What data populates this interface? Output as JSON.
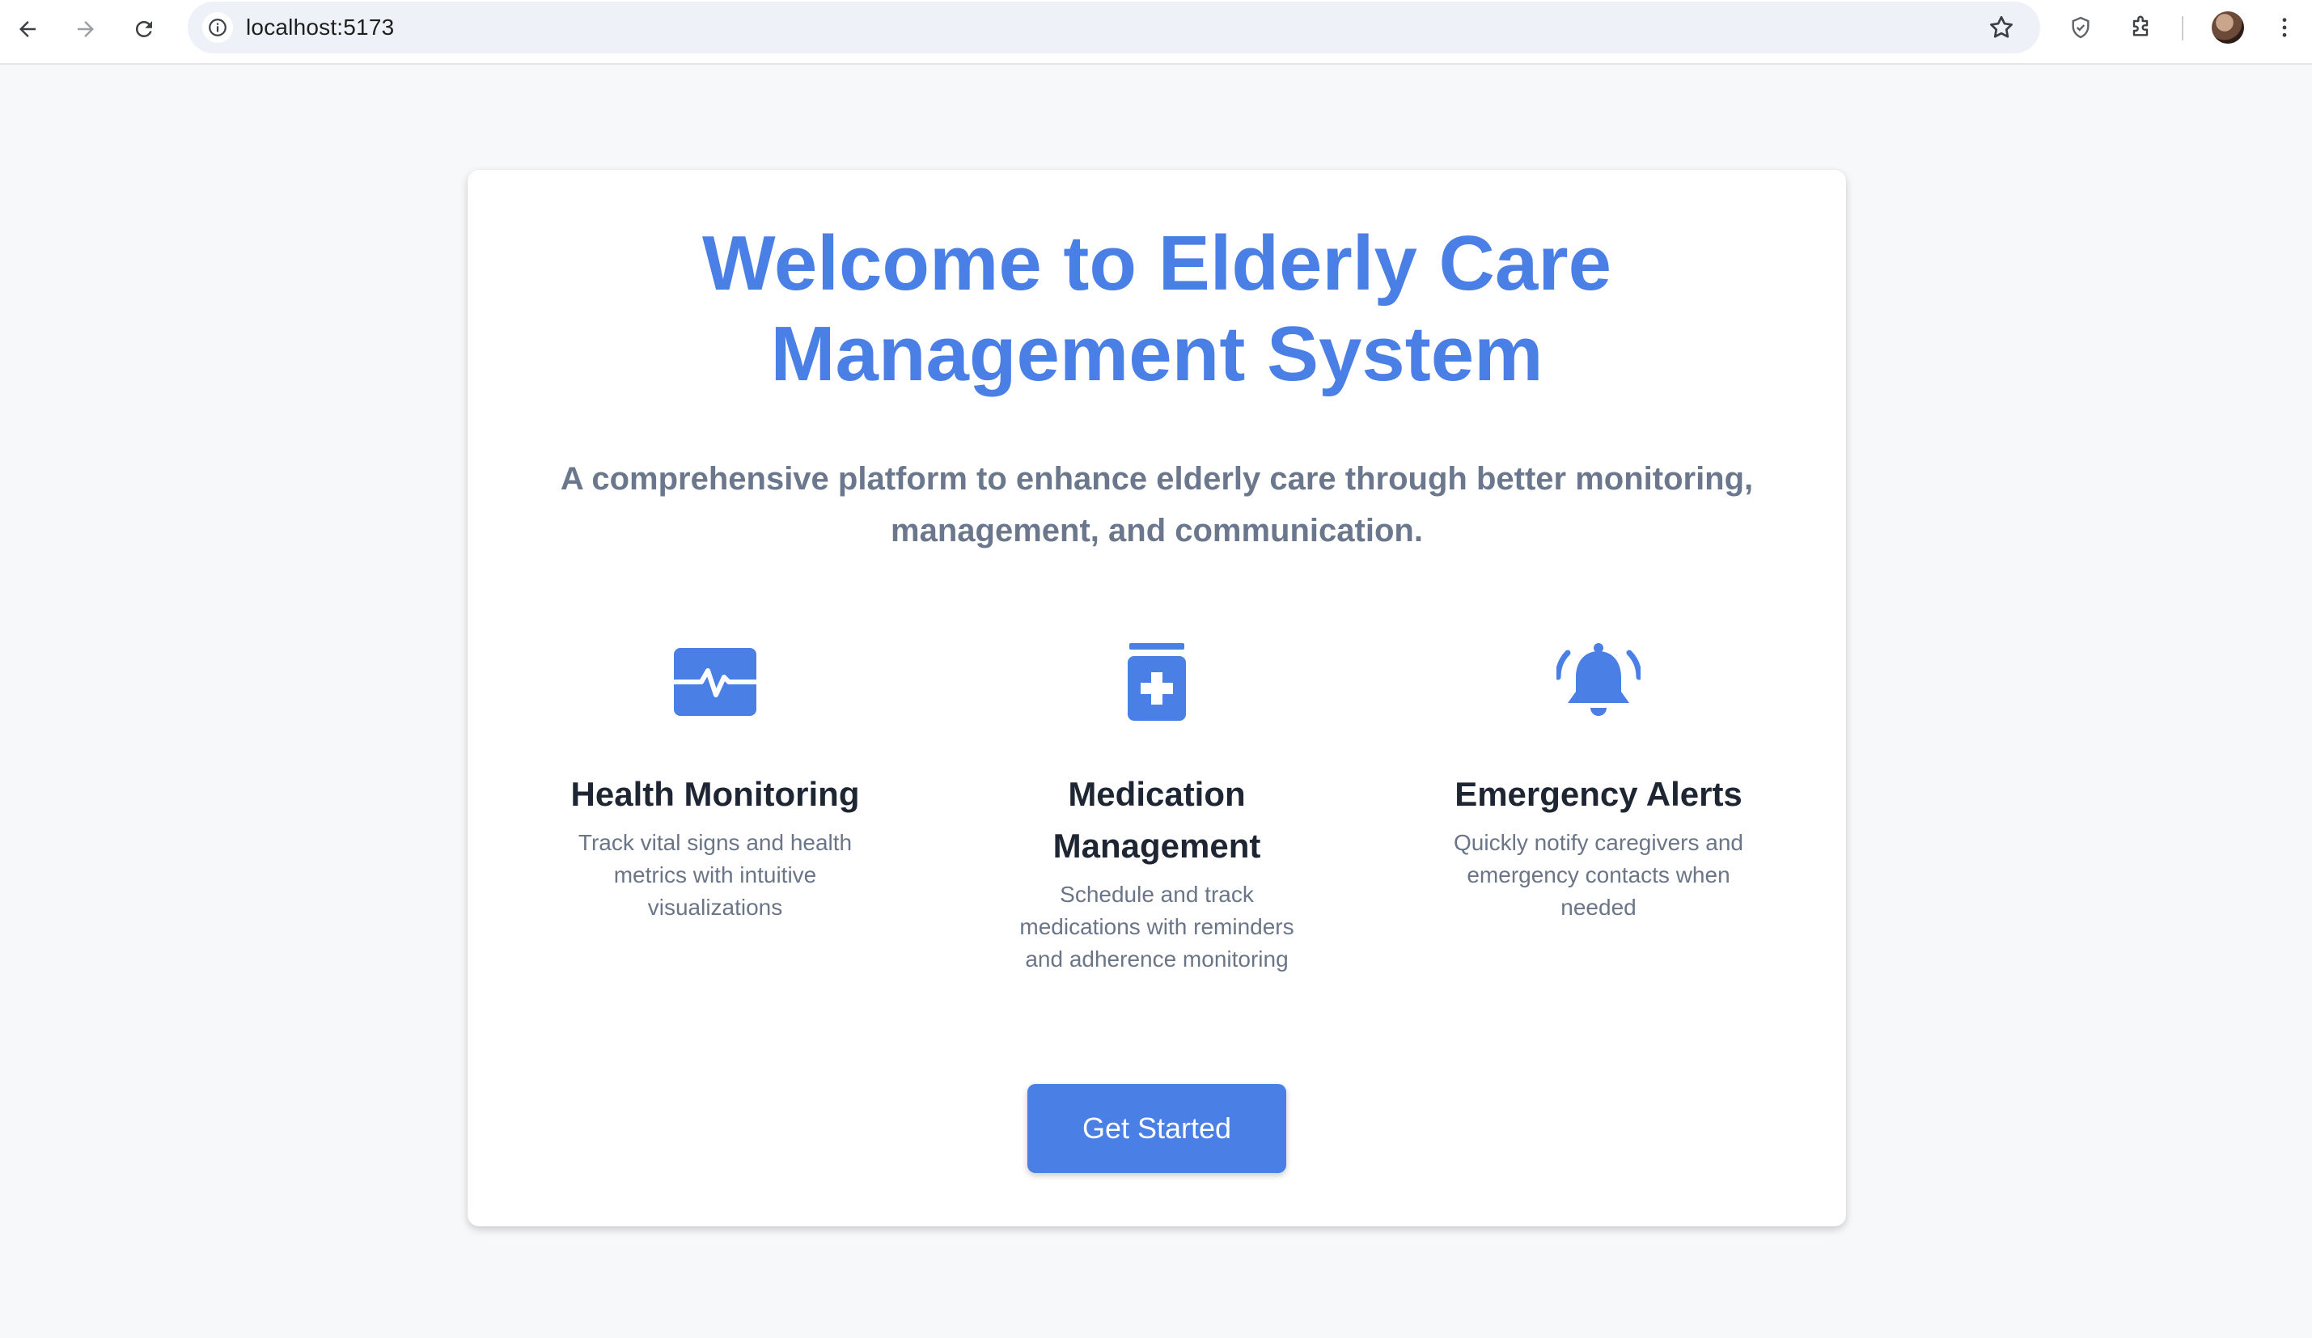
{
  "browser": {
    "url": "localhost:5173"
  },
  "hero": {
    "title_line1": "Welcome to Elderly Care",
    "title_line2": "Management System",
    "subtitle_line1": "A comprehensive platform to enhance elderly care through better monitoring,",
    "subtitle_line2": "management, and communication."
  },
  "features": [
    {
      "icon": "heartbeat-icon",
      "title_line1": "Health Monitoring",
      "title_line2": "",
      "desc_line1": "Track vital signs and health",
      "desc_line2": "metrics with intuitive",
      "desc_line3": "visualizations"
    },
    {
      "icon": "medication-bottle-icon",
      "title_line1": "Medication",
      "title_line2": "Management",
      "desc_line1": "Schedule and track",
      "desc_line2": "medications with reminders",
      "desc_line3": "and adherence monitoring"
    },
    {
      "icon": "alarm-bell-icon",
      "title_line1": "Emergency Alerts",
      "title_line2": "",
      "desc_line1": "Quickly notify caregivers and",
      "desc_line2": "emergency contacts when",
      "desc_line3": "needed"
    }
  ],
  "cta": {
    "label": "Get Started"
  },
  "colors": {
    "accent": "#4a7fe6",
    "heading": "#1e2533",
    "muted": "#6b7588",
    "background": "#f7f8fa"
  }
}
